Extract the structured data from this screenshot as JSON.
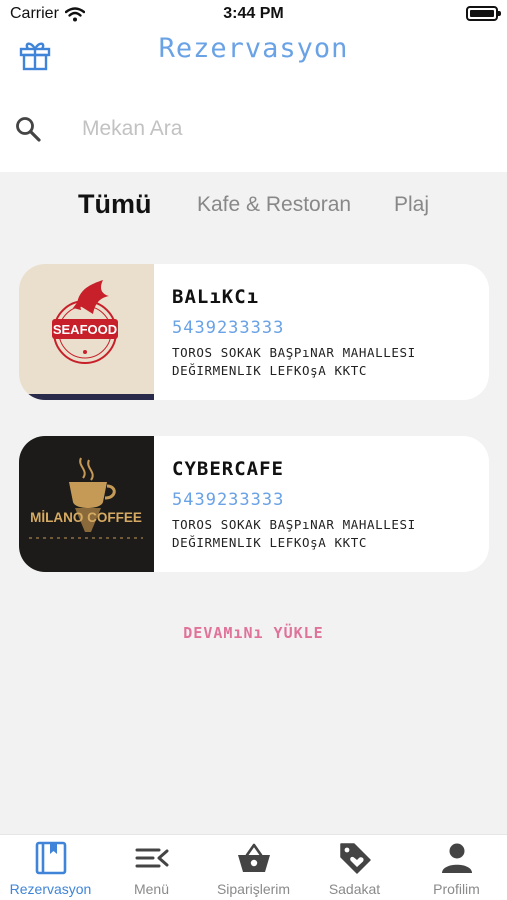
{
  "status_bar": {
    "carrier": "Carrier",
    "time": "3:44 PM"
  },
  "header": {
    "title": "Rezervasyon",
    "gift_icon": "gift-icon"
  },
  "search": {
    "placeholder": "Mekan Ara",
    "value": ""
  },
  "tabs": [
    {
      "label": "Tümü",
      "active": true
    },
    {
      "label": "Kafe & Restoran",
      "active": false
    },
    {
      "label": "Plaj",
      "active": false
    }
  ],
  "venues": [
    {
      "name": "BALıKCı",
      "phone": "5439233333",
      "address": "TOROS SOKAK BAŞPıNAR MAHALLESI DEĞIRMENLIK LEFKOşA KKTC",
      "logo_text": "SEAFOOD"
    },
    {
      "name": "CYBERCAFE",
      "phone": "5439233333",
      "address": "TOROS SOKAK BAŞPıNAR MAHALLESI DEĞIRMENLIK LEFKOşA KKTC",
      "logo_text": "MİLANO COFFEE"
    }
  ],
  "load_more": "DEVAMıNı YÜKLE",
  "tab_bar": [
    {
      "label": "Rezervasyon",
      "icon": "book-icon",
      "active": true
    },
    {
      "label": "Menü",
      "icon": "menu-icon",
      "active": false
    },
    {
      "label": "Siparişlerim",
      "icon": "basket-icon",
      "active": false
    },
    {
      "label": "Sadakat",
      "icon": "tag-heart-icon",
      "active": false
    },
    {
      "label": "Profilim",
      "icon": "person-icon",
      "active": false
    }
  ],
  "colors": {
    "accent": "#3f84d8",
    "title": "#6aa2e6",
    "load_more": "#e0739a",
    "background": "#f2f2f2"
  }
}
